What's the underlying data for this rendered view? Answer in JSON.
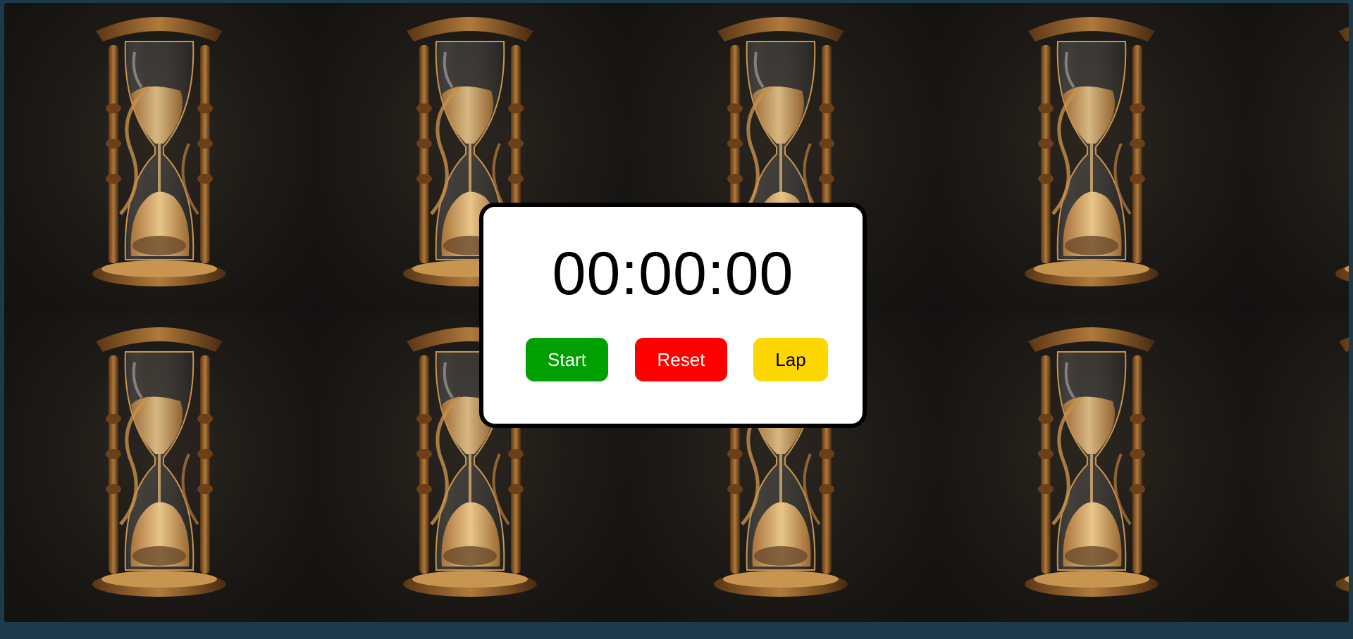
{
  "stopwatch": {
    "time": "00:00:00",
    "start_label": "Start",
    "reset_label": "Reset",
    "lap_label": "Lap"
  },
  "colors": {
    "start": "#00a000",
    "reset": "#ff0000",
    "lap": "#ffd700",
    "card": "#ffffff",
    "sand": "#d9a760"
  },
  "background": {
    "icon": "hourglass-icon"
  }
}
